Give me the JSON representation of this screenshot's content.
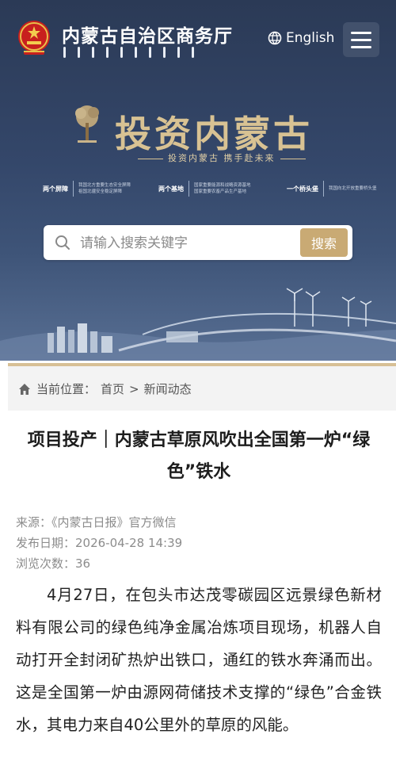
{
  "header": {
    "site_title": "内蒙古自治区商务厅",
    "lang_label": "English"
  },
  "banner": {
    "title": "投资内蒙古",
    "slogan": "投资内蒙古  携手赴未来",
    "pillars": [
      {
        "name": "两个屏障",
        "desc1": "我国北方重要生态安全屏障",
        "desc2": "祖国北疆安全稳定屏障"
      },
      {
        "name": "两个基地",
        "desc1": "国家重要能源和战略资源基地",
        "desc2": "国家重要农畜产品生产基地"
      },
      {
        "name": "一个桥头堡",
        "desc1": "我国向北开放重要桥头堡",
        "desc2": ""
      }
    ]
  },
  "search": {
    "placeholder": "请输入搜索关键字",
    "button_label": "搜索"
  },
  "breadcrumb": {
    "prefix": "当前位置：",
    "home": "首页",
    "separator": ">",
    "current": "新闻动态"
  },
  "article": {
    "title": "项目投产｜内蒙古草原风吹出全国第一炉“绿色”铁水",
    "source": "来源：《内蒙古日报》官方微信",
    "date": "发布日期：2026-04-28 14:39",
    "views": "浏览次数：36",
    "paragraph": "4月27日，在包头市达茂零碳园区远景绿色新材料有限公司的绿色纯净金属冶炼项目现场，机器人自动打开全封闭矿热炉出铁口，通红的铁水奔涌而出。这是全国第一炉由源网荷储技术支撑的“绿色”合金铁水，其电力来自40公里外的草原的风能。"
  },
  "colors": {
    "hero_dark": "#2b3a56",
    "gold": "#c9aa74",
    "breadcrumb_border": "#d7bf95"
  }
}
